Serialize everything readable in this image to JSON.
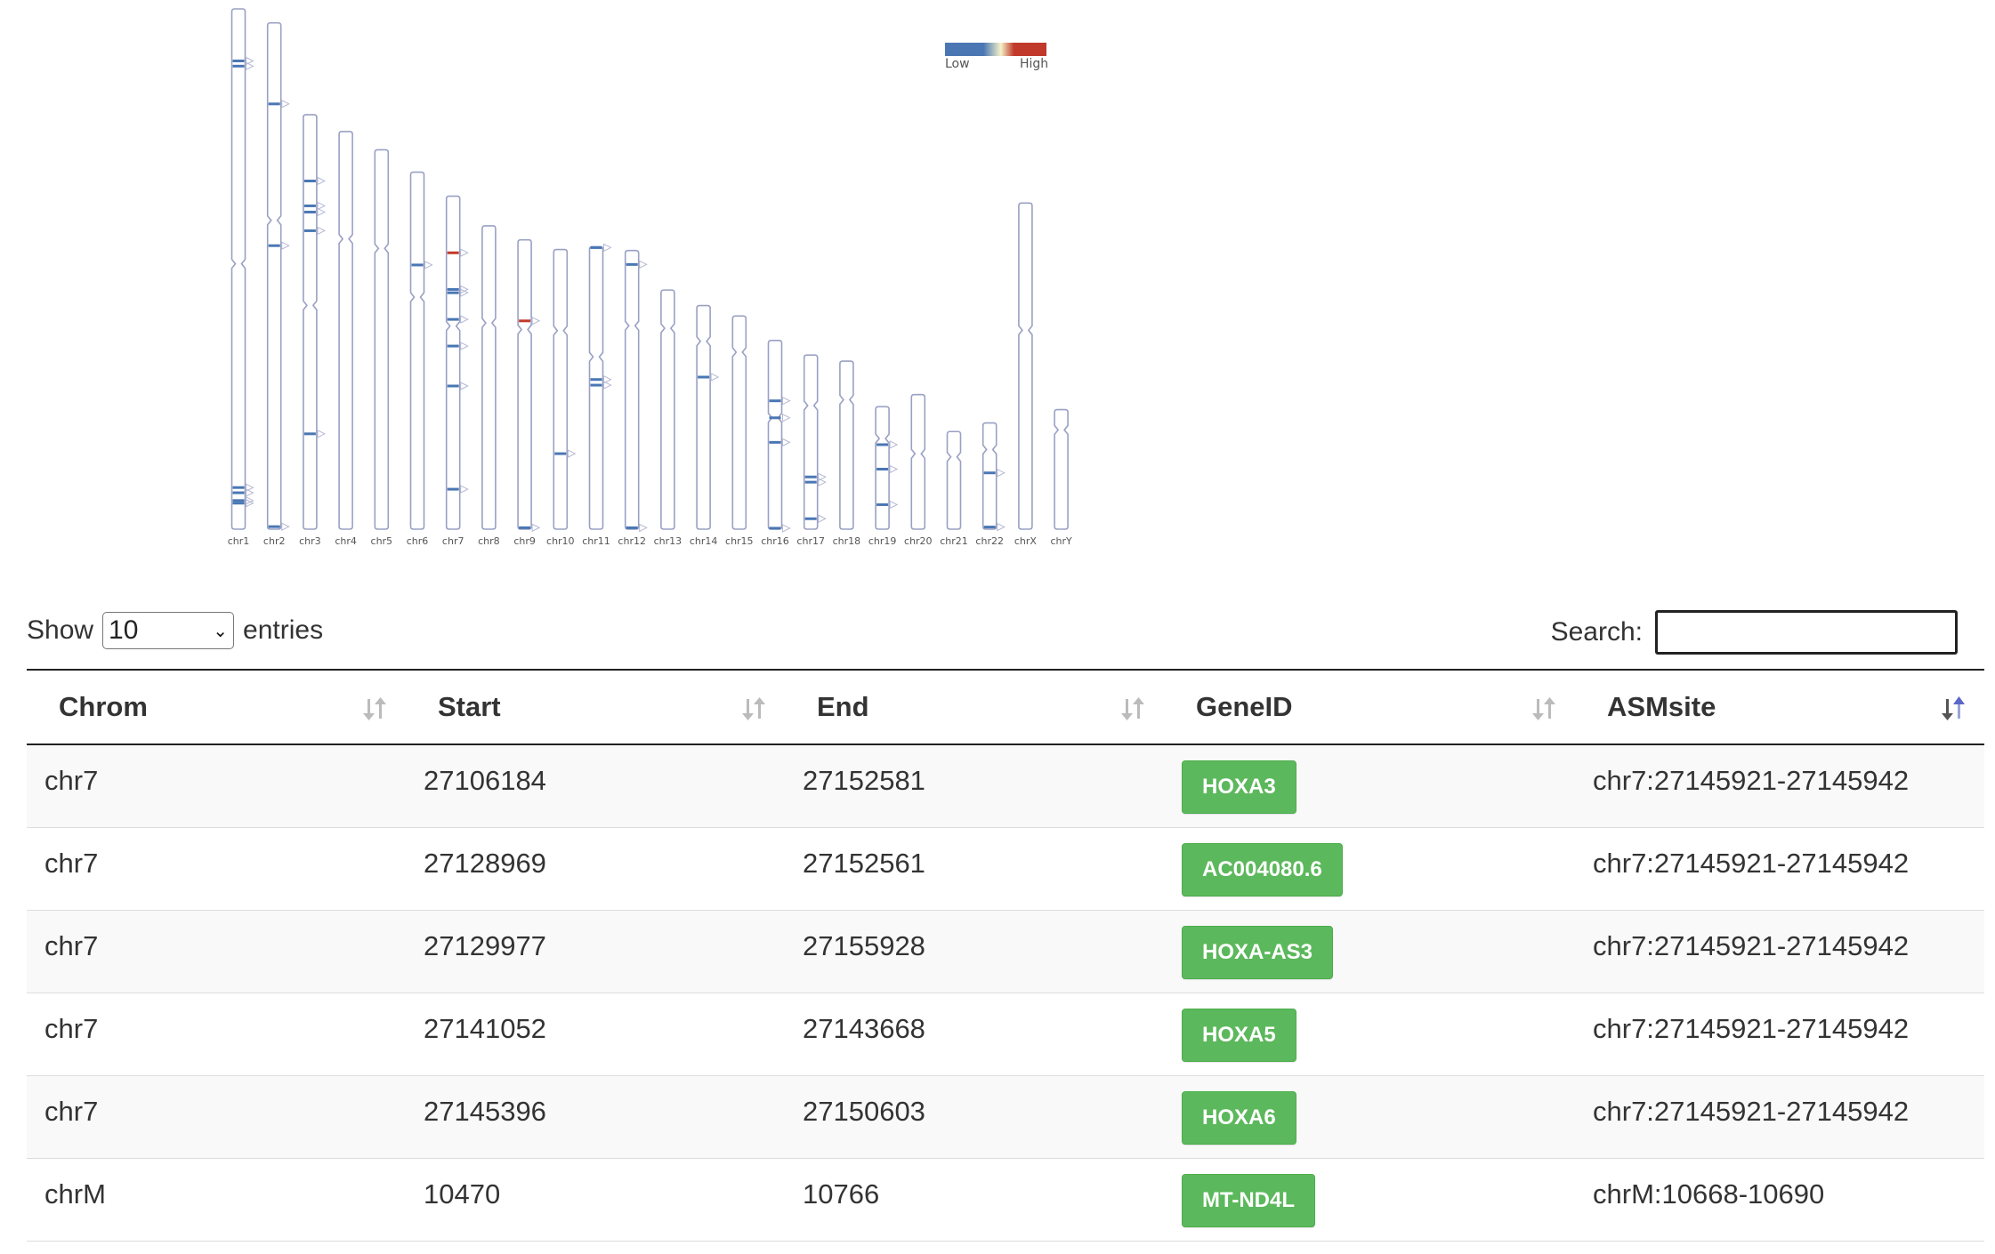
{
  "chart_data": {
    "type": "ideogram",
    "legend": {
      "low_label": "Low",
      "high_label": "High",
      "low_color": "#4a77b4",
      "mid_color": "#f5f2c8",
      "high_color": "#c0392b"
    },
    "chromosomes": [
      {
        "name": "chr1",
        "length": 248.9,
        "centromere": 0.49,
        "marks": [
          {
            "pos": 0.1,
            "level": "low"
          },
          {
            "pos": 0.11,
            "level": "low"
          },
          {
            "pos": 0.92,
            "level": "low"
          },
          {
            "pos": 0.93,
            "level": "low"
          },
          {
            "pos": 0.945,
            "level": "low"
          },
          {
            "pos": 0.95,
            "level": "low"
          }
        ]
      },
      {
        "name": "chr2",
        "length": 242.2,
        "centromere": 0.39,
        "marks": [
          {
            "pos": 0.16,
            "level": "low"
          },
          {
            "pos": 0.44,
            "level": "low"
          },
          {
            "pos": 0.995,
            "level": "low"
          }
        ]
      },
      {
        "name": "chr3",
        "length": 198.3,
        "centromere": 0.46,
        "marks": [
          {
            "pos": 0.16,
            "level": "low"
          },
          {
            "pos": 0.22,
            "level": "low"
          },
          {
            "pos": 0.235,
            "level": "low"
          },
          {
            "pos": 0.28,
            "level": "low"
          },
          {
            "pos": 0.77,
            "level": "low"
          }
        ]
      },
      {
        "name": "chr4",
        "length": 190.2,
        "centromere": 0.27,
        "marks": []
      },
      {
        "name": "chr5",
        "length": 181.5,
        "centromere": 0.26,
        "marks": []
      },
      {
        "name": "chr6",
        "length": 170.8,
        "centromere": 0.35,
        "marks": [
          {
            "pos": 0.26,
            "level": "low"
          }
        ]
      },
      {
        "name": "chr7",
        "length": 159.3,
        "centromere": 0.39,
        "marks": [
          {
            "pos": 0.17,
            "level": "high"
          },
          {
            "pos": 0.28,
            "level": "low"
          },
          {
            "pos": 0.29,
            "level": "low"
          },
          {
            "pos": 0.37,
            "level": "low"
          },
          {
            "pos": 0.45,
            "level": "low"
          },
          {
            "pos": 0.57,
            "level": "low"
          },
          {
            "pos": 0.88,
            "level": "low"
          }
        ]
      },
      {
        "name": "chr8",
        "length": 145.1,
        "centromere": 0.32,
        "marks": []
      },
      {
        "name": "chr9",
        "length": 138.4,
        "centromere": 0.31,
        "marks": [
          {
            "pos": 0.28,
            "level": "high"
          },
          {
            "pos": 0.995,
            "level": "low"
          }
        ]
      },
      {
        "name": "chr10",
        "length": 133.8,
        "centromere": 0.29,
        "marks": [
          {
            "pos": 0.73,
            "level": "low"
          }
        ]
      },
      {
        "name": "chr11",
        "length": 135.1,
        "centromere": 0.39,
        "marks": [
          {
            "pos": 0.003,
            "level": "low"
          },
          {
            "pos": 0.47,
            "level": "low"
          },
          {
            "pos": 0.49,
            "level": "low"
          }
        ]
      },
      {
        "name": "chr12",
        "length": 133.3,
        "centromere": 0.27,
        "marks": [
          {
            "pos": 0.05,
            "level": "low"
          },
          {
            "pos": 0.995,
            "level": "low"
          }
        ]
      },
      {
        "name": "chr13",
        "length": 114.4,
        "centromere": 0.16,
        "marks": []
      },
      {
        "name": "chr14",
        "length": 107.0,
        "centromere": 0.16,
        "marks": [
          {
            "pos": 0.32,
            "level": "low"
          }
        ]
      },
      {
        "name": "chr15",
        "length": 102.0,
        "centromere": 0.17,
        "marks": []
      },
      {
        "name": "chr16",
        "length": 90.3,
        "centromere": 0.41,
        "marks": [
          {
            "pos": 0.32,
            "level": "low"
          },
          {
            "pos": 0.41,
            "level": "low"
          },
          {
            "pos": 0.54,
            "level": "low"
          },
          {
            "pos": 0.995,
            "level": "low"
          }
        ]
      },
      {
        "name": "chr17",
        "length": 83.3,
        "centromere": 0.29,
        "marks": [
          {
            "pos": 0.7,
            "level": "low"
          },
          {
            "pos": 0.73,
            "level": "low"
          },
          {
            "pos": 0.94,
            "level": "low"
          }
        ]
      },
      {
        "name": "chr18",
        "length": 80.4,
        "centromere": 0.23,
        "marks": []
      },
      {
        "name": "chr19",
        "length": 58.6,
        "centromere": 0.26,
        "marks": [
          {
            "pos": 0.31,
            "level": "low"
          },
          {
            "pos": 0.51,
            "level": "low"
          },
          {
            "pos": 0.8,
            "level": "low"
          }
        ]
      },
      {
        "name": "chr20",
        "length": 64.4,
        "centromere": 0.44,
        "marks": []
      },
      {
        "name": "chr21",
        "length": 46.7,
        "centromere": 0.26,
        "marks": []
      },
      {
        "name": "chr22",
        "length": 50.8,
        "centromere": 0.25,
        "marks": [
          {
            "pos": 0.47,
            "level": "low"
          },
          {
            "pos": 0.98,
            "level": "low"
          }
        ]
      },
      {
        "name": "chrX",
        "length": 156.0,
        "centromere": 0.39,
        "marks": []
      },
      {
        "name": "chrY",
        "length": 57.2,
        "centromere": 0.17,
        "marks": []
      }
    ]
  },
  "controls": {
    "show_label": "Show",
    "entries_label": "entries",
    "page_length": "10",
    "search_label": "Search:",
    "search_value": ""
  },
  "table": {
    "columns": [
      "Chrom",
      "Start",
      "End",
      "GeneID",
      "ASMsite"
    ],
    "rows": [
      {
        "chrom": "chr7",
        "start": "27106184",
        "end": "27152581",
        "gene": "HOXA3",
        "asm": "chr7:27145921-27145942"
      },
      {
        "chrom": "chr7",
        "start": "27128969",
        "end": "27152561",
        "gene": "AC004080.6",
        "asm": "chr7:27145921-27145942"
      },
      {
        "chrom": "chr7",
        "start": "27129977",
        "end": "27155928",
        "gene": "HOXA-AS3",
        "asm": "chr7:27145921-27145942"
      },
      {
        "chrom": "chr7",
        "start": "27141052",
        "end": "27143668",
        "gene": "HOXA5",
        "asm": "chr7:27145921-27145942"
      },
      {
        "chrom": "chr7",
        "start": "27145396",
        "end": "27150603",
        "gene": "HOXA6",
        "asm": "chr7:27145921-27145942"
      },
      {
        "chrom": "chrM",
        "start": "10470",
        "end": "10766",
        "gene": "MT-ND4L",
        "asm": "chrM:10668-10690"
      }
    ]
  }
}
